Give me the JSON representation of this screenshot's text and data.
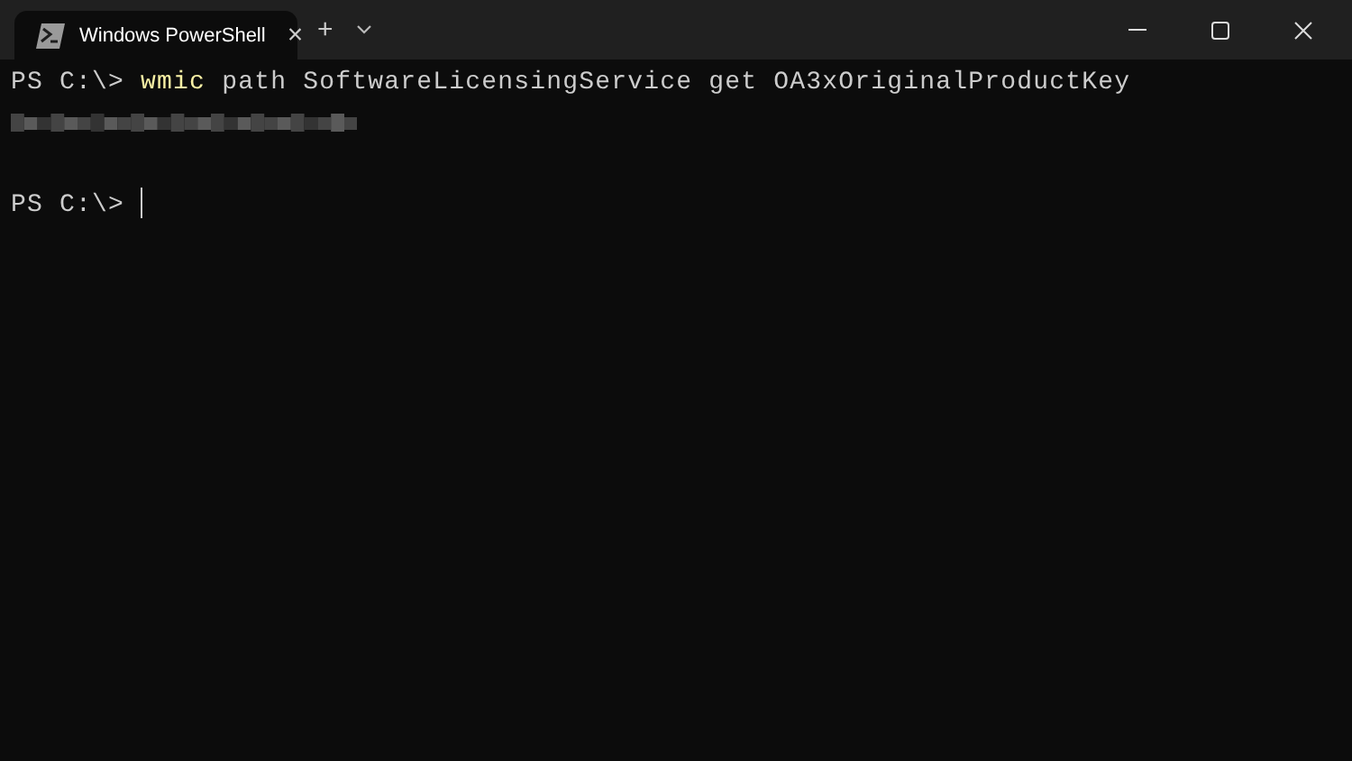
{
  "tabs": [
    {
      "title": "Windows PowerShell",
      "close": "×",
      "selected": true
    }
  ],
  "new_tab": "+",
  "lines": [
    {
      "kind": "command",
      "prompt": "PS C:\\>",
      "command": "wmic",
      "args": "path SoftwareLicensingService get OA3xOriginalProductKey"
    },
    {
      "kind": "redacted"
    },
    {
      "kind": "blank"
    },
    {
      "kind": "prompt",
      "prompt": "PS C:\\>"
    }
  ]
}
